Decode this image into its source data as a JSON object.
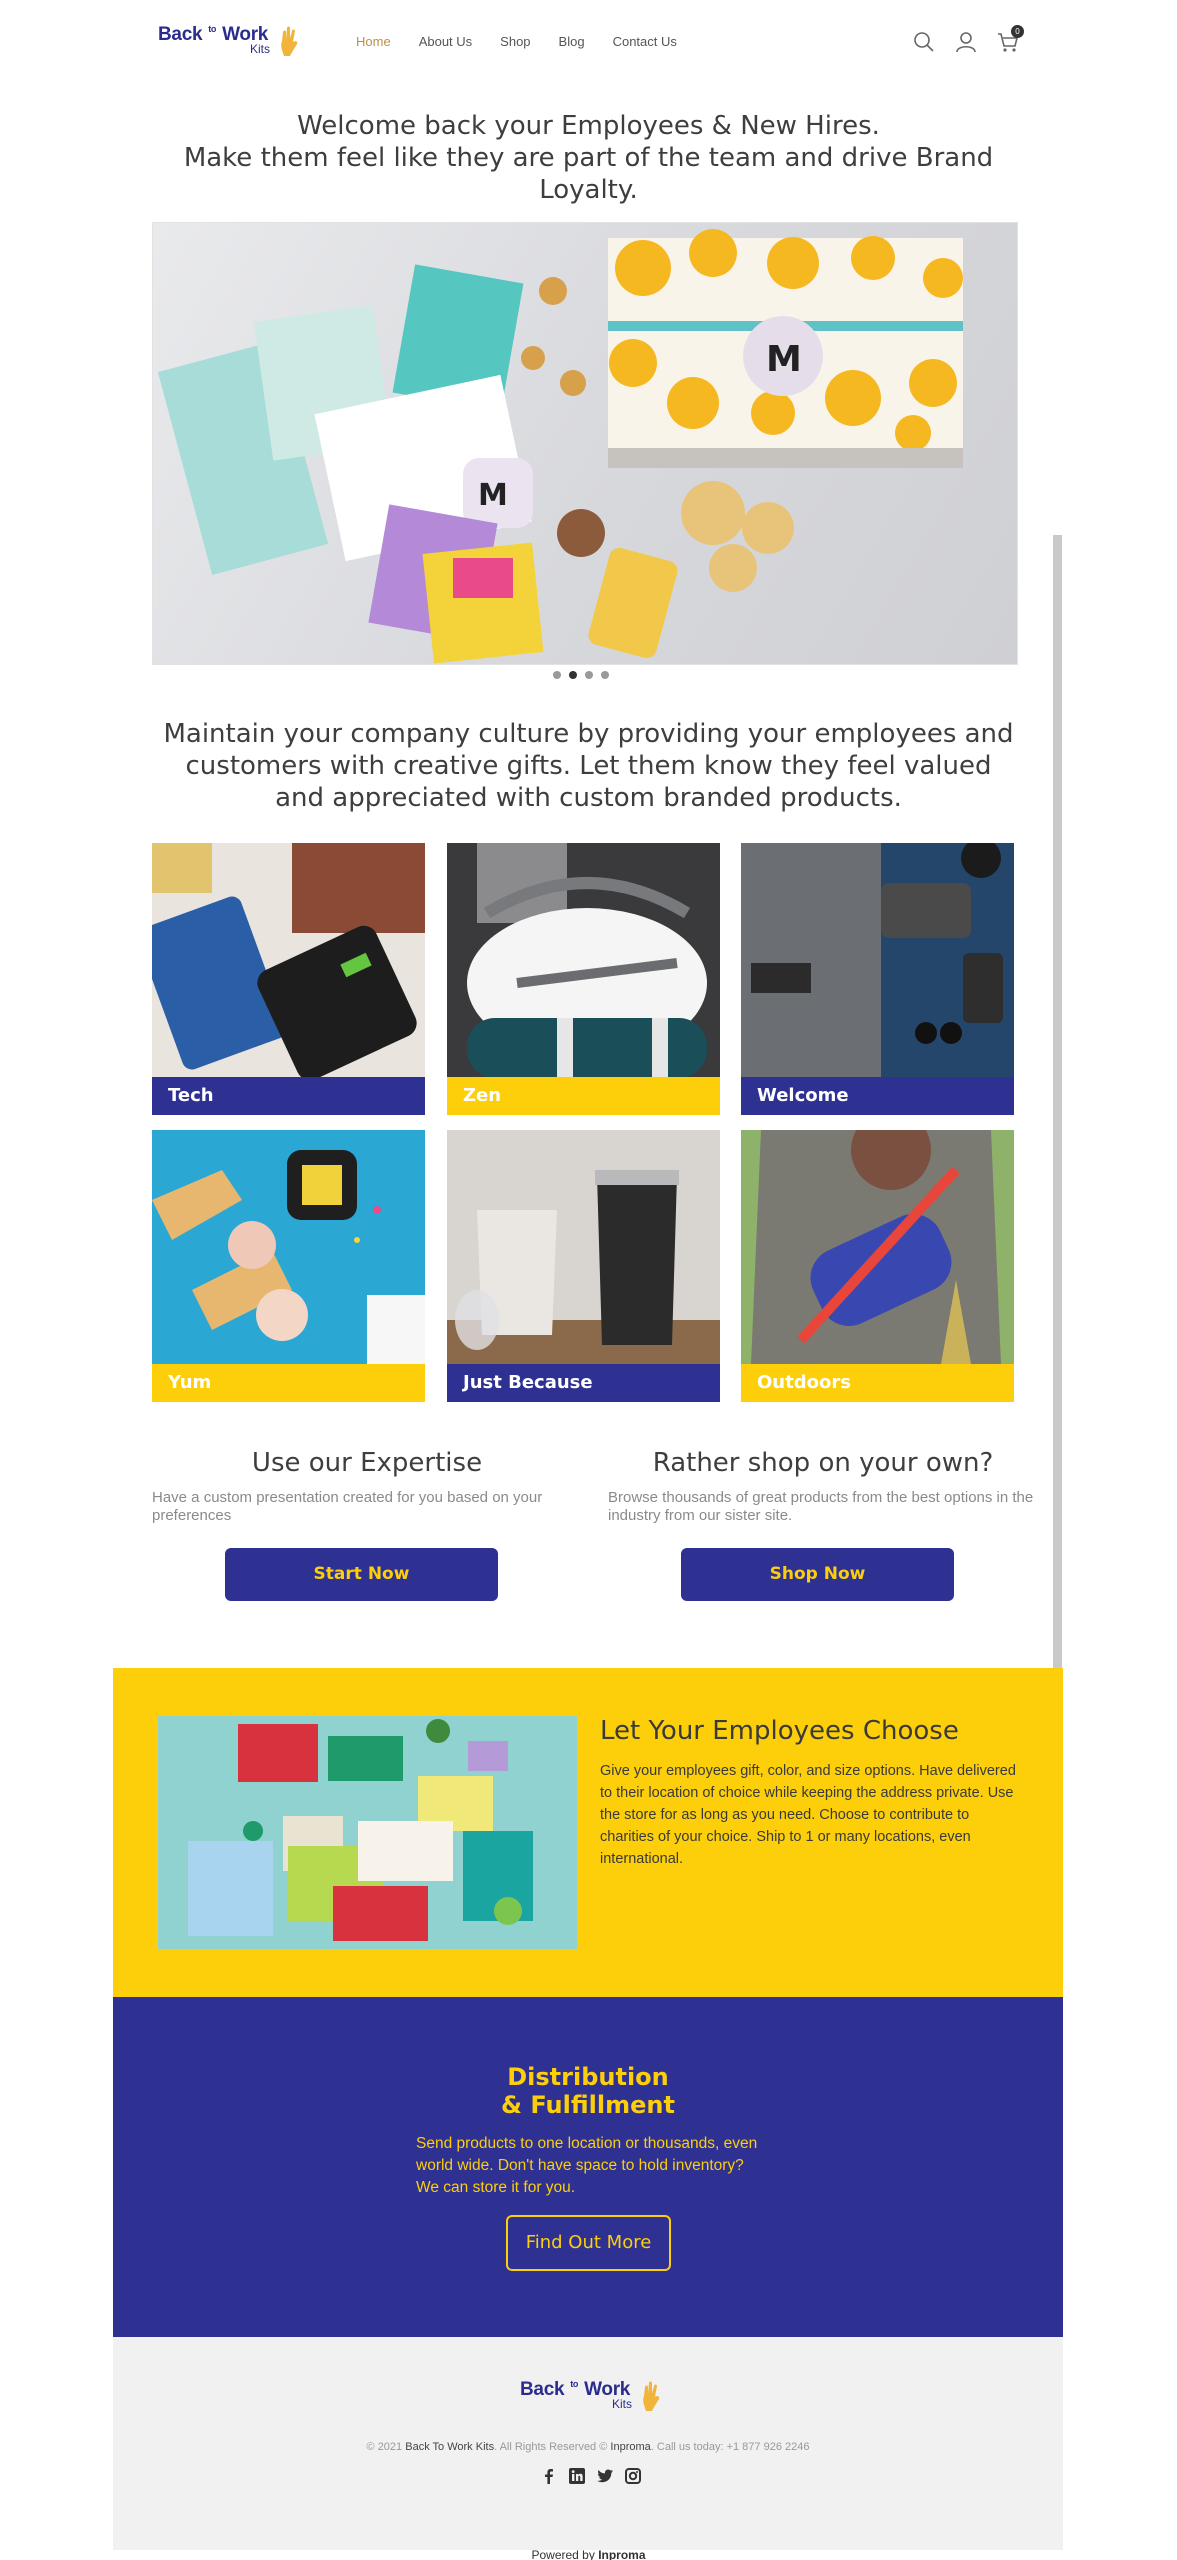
{
  "header": {
    "logo_main": "Back",
    "logo_to": "to",
    "logo_work": "Work",
    "logo_sub": "Kits",
    "nav": [
      "Home",
      "About Us",
      "Shop",
      "Blog",
      "Contact Us"
    ],
    "cart_count": "0",
    "icons": [
      "search-icon",
      "user-icon",
      "cart-icon"
    ]
  },
  "hero": {
    "title_line1": "Welcome back your Employees & New Hires.",
    "title_line2": "Make them feel like they are part of the team and drive Brand Loyalty."
  },
  "slider": {
    "slides": 4,
    "active_slide": 2
  },
  "culture": {
    "text": "Maintain your company culture by providing your employees and customers with creative gifts. Let them know they feel valued and appreciated with custom branded products."
  },
  "categories": [
    {
      "label": "Tech",
      "color": "#2e3192"
    },
    {
      "label": "Zen",
      "color": "#fccf0a"
    },
    {
      "label": "Welcome",
      "color": "#2e3192"
    },
    {
      "label": "Yum",
      "color": "#fccf0a"
    },
    {
      "label": "Just Because",
      "color": "#2e3192"
    },
    {
      "label": "Outdoors",
      "color": "#fccf0a"
    }
  ],
  "expertise": {
    "title": "Use our Expertise",
    "text": "Have a custom presentation created for you based on your preferences",
    "button": "Start Now"
  },
  "own": {
    "title": "Rather shop on your own?",
    "text": "Browse thousands of great products from the best options in the industry from our sister site.",
    "button": "Shop Now"
  },
  "choose": {
    "title": "Let Your Employees Choose",
    "text": "Give your employees gift, color, and size options. Have delivered to their location of choice while keeping the address private. Use the store for as long as you need. Choose to contribute to charities of your choice. Ship to 1 or many locations, even international."
  },
  "distribution": {
    "title_line1": "Distribution",
    "title_line2": "& Fulfillment",
    "text": "Send products to one location or thousands, even world wide. Don't have space to hold inventory? We can store it for you.",
    "button": "Find Out More"
  },
  "footer": {
    "copyright_pre": "© 2021",
    "copyright_brand": "Back To Work Kits",
    "copyright_mid": ". All Rights Reserved ©",
    "copyright_inproma": "Inproma",
    "copyright_post": ". Call us today: +1 877 926 2246",
    "socials": [
      "facebook-icon",
      "linkedin-icon",
      "twitter-icon",
      "instagram-icon"
    ],
    "powered_pre": "Powered by",
    "powered_brand": "Inproma"
  },
  "colors": {
    "brand_blue": "#2e3192",
    "brand_yellow": "#fccf0a",
    "nav_active": "#b8924a"
  }
}
